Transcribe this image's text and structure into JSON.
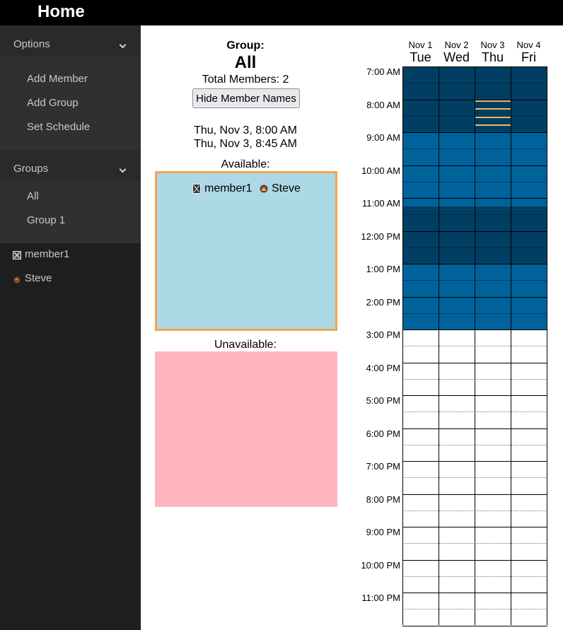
{
  "header": {
    "title": "Home"
  },
  "sidebar": {
    "options": {
      "title": "Options",
      "items": [
        "Add Member",
        "Add Group",
        "Set Schedule"
      ]
    },
    "groups": {
      "title": "Groups",
      "items": [
        "All",
        "Group 1"
      ]
    },
    "members": [
      {
        "name": "member1",
        "icon": "member1-avatar-icon"
      },
      {
        "name": "Steve",
        "icon": "steve-avatar-icon"
      }
    ]
  },
  "group_info": {
    "label": "Group:",
    "name": "All",
    "total_members": "Total Members: 2",
    "toggle_button": "Hide Member Names",
    "range_start": "Thu, Nov 3, 8:00 AM",
    "range_end": "Thu, Nov 3, 8:45 AM",
    "available_label": "Available:",
    "available_members": [
      "member1",
      "Steve"
    ],
    "unavailable_label": "Unavailable:",
    "unavailable_members": []
  },
  "schedule": {
    "days": [
      {
        "date": "Nov 1",
        "weekday": "Tue"
      },
      {
        "date": "Nov 2",
        "weekday": "Wed"
      },
      {
        "date": "Nov 3",
        "weekday": "Thu"
      },
      {
        "date": "Nov 4",
        "weekday": "Fri"
      }
    ],
    "hours": [
      "7:00 AM",
      "8:00 AM",
      "9:00 AM",
      "10:00 AM",
      "11:00 AM",
      "12:00 PM",
      "1:00 PM",
      "2:00 PM",
      "3:00 PM",
      "4:00 PM",
      "5:00 PM",
      "6:00 PM",
      "7:00 PM",
      "8:00 PM",
      "9:00 PM",
      "10:00 PM",
      "11:00 PM"
    ],
    "availability_blocks": [
      {
        "from": "7:00 AM",
        "to": "9:00 AM",
        "level": "all",
        "color": "#003f63"
      },
      {
        "from": "9:00 AM",
        "to": "11:15 AM",
        "level": "some",
        "color": "#00629b"
      },
      {
        "from": "11:15 AM",
        "to": "1:00 PM",
        "level": "all",
        "color": "#003f63"
      },
      {
        "from": "1:00 PM",
        "to": "3:00 PM",
        "level": "some",
        "color": "#00629b"
      }
    ],
    "selection": {
      "day": "Nov 3",
      "from": "8:00 AM",
      "to": "8:45 AM",
      "color": "#f0b860"
    }
  },
  "colors": {
    "available_bg": "#add8e6",
    "available_border": "#f4a549",
    "unavailable_bg": "#ffb6c1",
    "sidebar_bg": "#1e1e1e"
  }
}
